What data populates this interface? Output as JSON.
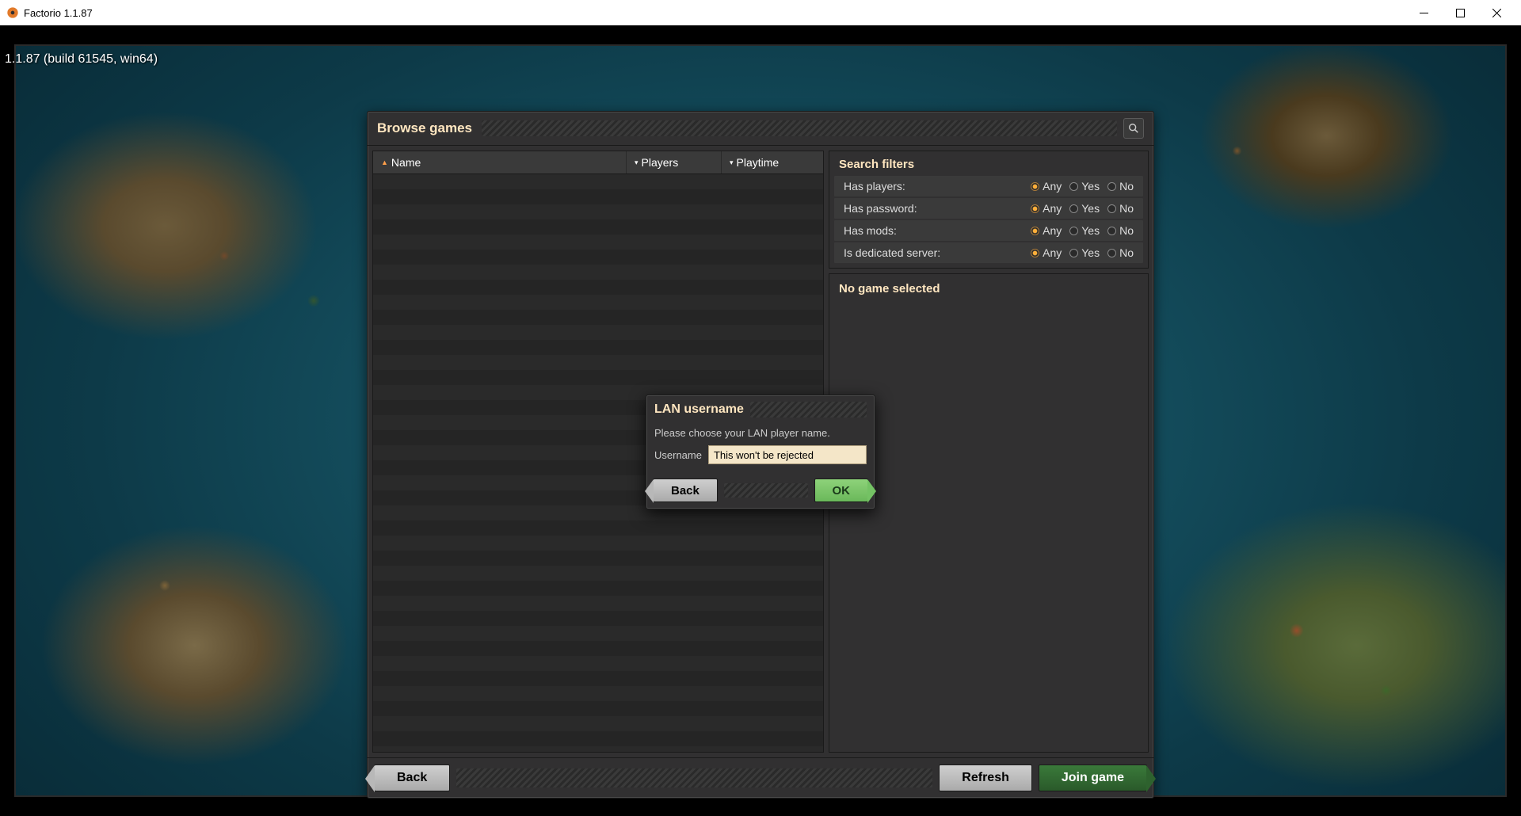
{
  "window": {
    "title": "Factorio 1.1.87"
  },
  "version_overlay": "1.1.87 (build 61545, win64)",
  "browse": {
    "title": "Browse games",
    "columns": {
      "name": "Name",
      "players": "Players",
      "playtime": "Playtime"
    }
  },
  "filters": {
    "title": "Search filters",
    "rows": [
      {
        "label": "Has players:",
        "selected": "Any",
        "options": [
          "Any",
          "Yes",
          "No"
        ]
      },
      {
        "label": "Has password:",
        "selected": "Any",
        "options": [
          "Any",
          "Yes",
          "No"
        ]
      },
      {
        "label": "Has mods:",
        "selected": "Any",
        "options": [
          "Any",
          "Yes",
          "No"
        ]
      },
      {
        "label": "Is dedicated server:",
        "selected": "Any",
        "options": [
          "Any",
          "Yes",
          "No"
        ]
      }
    ],
    "opt_any": "Any",
    "opt_yes": "Yes",
    "opt_no": "No"
  },
  "details": {
    "no_game": "No game selected"
  },
  "footer": {
    "back": "Back",
    "refresh": "Refresh",
    "join": "Join game"
  },
  "modal": {
    "title": "LAN username",
    "message": "Please choose your LAN player name.",
    "username_label": "Username",
    "username_value": "This won't be rejected",
    "back": "Back",
    "ok": "OK"
  }
}
